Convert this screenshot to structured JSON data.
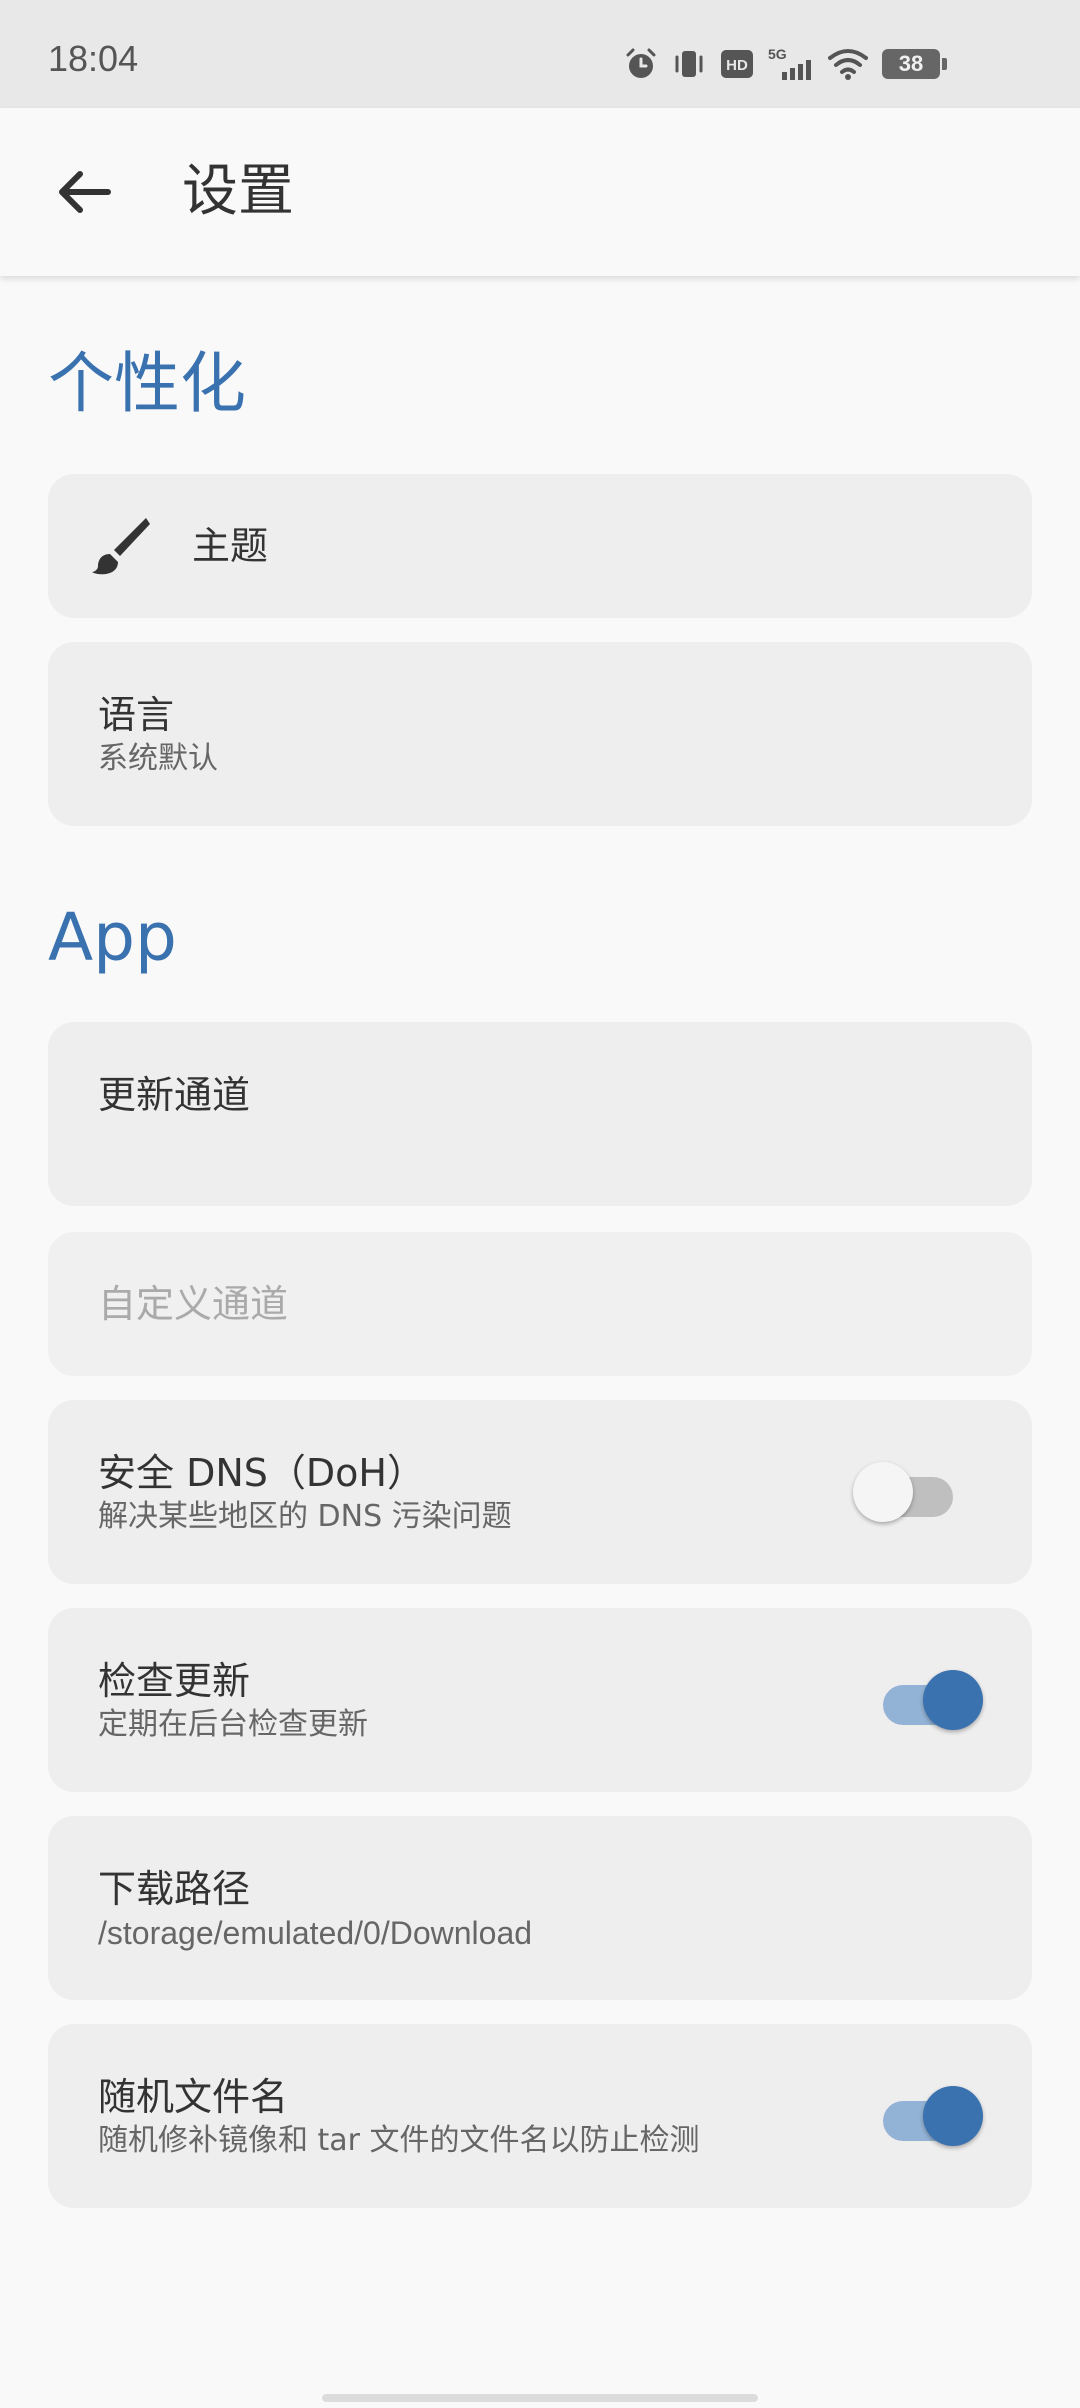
{
  "status_bar": {
    "time": "18:04",
    "icons": [
      "alarm-icon",
      "vibrate-icon",
      "hd-icon",
      "5g-signal-icon",
      "wifi-icon"
    ],
    "battery_level": "38"
  },
  "app_bar": {
    "title": "设置"
  },
  "sections": {
    "personalization": {
      "header": "个性化",
      "theme": {
        "title": "主题",
        "icon": "brush-icon"
      },
      "language": {
        "title": "语言",
        "subtitle": "系统默认"
      }
    },
    "app": {
      "header": "App",
      "update_channel": {
        "title": "更新通道"
      },
      "custom_channel": {
        "title": "自定义通道",
        "disabled": true
      },
      "secure_dns": {
        "title": "安全 DNS（DoH）",
        "subtitle": "解决某些地区的 DNS 污染问题",
        "enabled": false
      },
      "check_updates": {
        "title": "检查更新",
        "subtitle": "定期在后台检查更新",
        "enabled": true
      },
      "download_path": {
        "title": "下载路径",
        "subtitle": "/storage/emulated/0/Download"
      },
      "random_filename": {
        "title": "随机文件名",
        "subtitle": "随机修补镜像和 tar 文件的文件名以防止检测",
        "enabled": true
      }
    }
  },
  "colors": {
    "accent": "#3a72b0",
    "card_bg": "#eeeeee",
    "page_bg": "#f9f9f9"
  }
}
